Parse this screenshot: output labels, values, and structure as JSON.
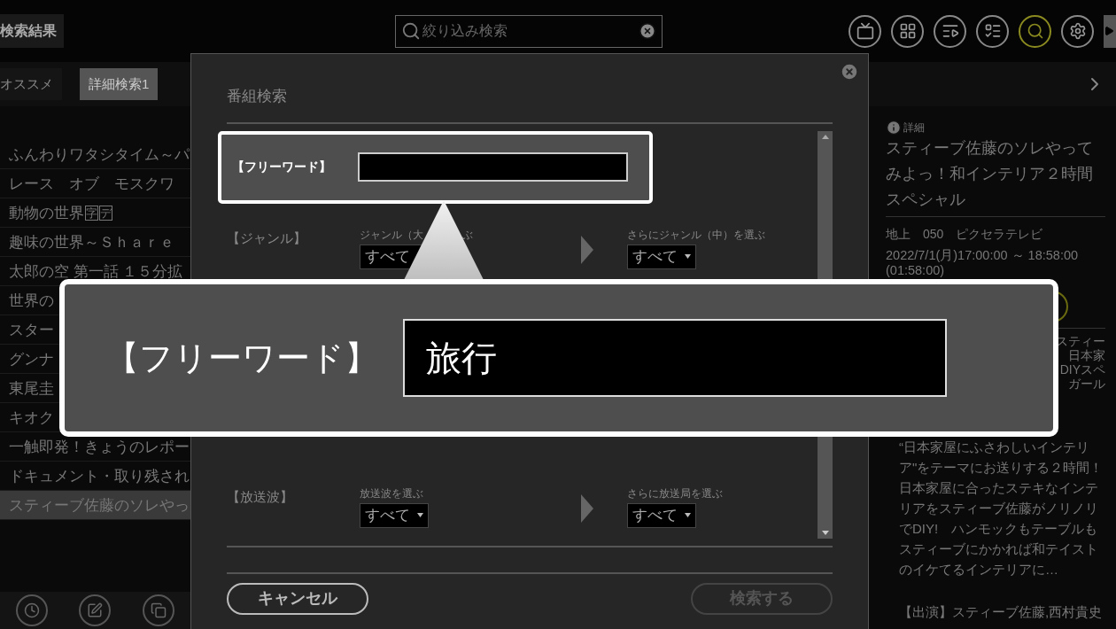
{
  "header": {
    "title": "検索結果",
    "search": {
      "placeholder": "絞り込み検索"
    },
    "toolbar": [
      {
        "kind": "tv",
        "selected": false
      },
      {
        "kind": "guide",
        "selected": false
      },
      {
        "kind": "playlist",
        "selected": false
      },
      {
        "kind": "schedule",
        "selected": false
      },
      {
        "kind": "search",
        "selected": true
      },
      {
        "kind": "settings",
        "selected": false
      }
    ]
  },
  "tabs": [
    {
      "label": "オススメ",
      "selected": false
    },
    {
      "label": "詳細検索1",
      "selected": true
    }
  ],
  "program_list": [
    {
      "title": "ふんわりワタシタイム～パ",
      "selected": false
    },
    {
      "title": "レース　オブ　モスクワ",
      "selected": false
    },
    {
      "title": "動物の世界",
      "badges": [
        "字",
        "デ"
      ],
      "selected": false
    },
    {
      "title": "趣味の世界～Ｓｈａｒｅ",
      "selected": false
    },
    {
      "title": "太郎の空 第一話 １５分拡",
      "selected": false
    },
    {
      "title": "世界の",
      "selected": false
    },
    {
      "title": "スター",
      "selected": false
    },
    {
      "title": "グンナ",
      "selected": false
    },
    {
      "title": "東尾圭",
      "selected": false
    },
    {
      "title": "キオク",
      "selected": false
    },
    {
      "title": "一触即発！きょうのレポー",
      "selected": false
    },
    {
      "title": "ドキュメント・取り残され",
      "selected": false
    },
    {
      "title": "スティーブ佐藤のソレやっ",
      "selected": true
    }
  ],
  "bottom_toolbar": [
    {
      "kind": "clock"
    },
    {
      "kind": "edit"
    },
    {
      "kind": "copy"
    }
  ],
  "details": {
    "heading": "詳細",
    "title": "スティーブ佐藤のソレやってみよっ！和インテリア２時間スペシャル",
    "channel": "地上　050　ピクセラテレビ",
    "time": "2022/7/1(月)17:00:00 ～ 18:58:00",
    "duration": "(01:58:00)",
    "fragments": [
      "スティー",
      "日本家",
      "DIYスペ",
      "ガール"
    ],
    "description": "“日本家屋にふさわしいインテリア\"をテーマにお送りする２時間！日本家屋に合ったステキなインテリアをスティーブ佐藤がノリノリでDIY!　ハンモックもテーブルもスティーブにかかれば和テイストのイケてるインテリアに…",
    "cast": "【出演】スティーブ佐藤,西村貴史"
  },
  "dialog": {
    "title": "番組検索",
    "rows": [
      {
        "kind": "text",
        "label": "【フリーワード】",
        "highlighted": true
      },
      {
        "kind": "select_pair",
        "label": "【ジャンル】",
        "first": {
          "caption": "ジャンル（大",
          "caption_tail": "ぶ",
          "value": "すべて"
        },
        "second": {
          "caption": "さらにジャンル（中）を選ぶ",
          "value": "すべて"
        }
      },
      {
        "kind": "select_pair",
        "label": "【放送波】",
        "first": {
          "caption": "放送波を選ぶ",
          "value": "すべて"
        },
        "second": {
          "caption": "さらに放送局を選ぶ",
          "value": "すべて"
        }
      }
    ],
    "buttons": [
      {
        "label": "キャンセル",
        "disabled": false
      },
      {
        "label": "検索する",
        "disabled": true
      }
    ]
  },
  "callout": {
    "label": "【フリーワード】",
    "value": "旅行"
  }
}
